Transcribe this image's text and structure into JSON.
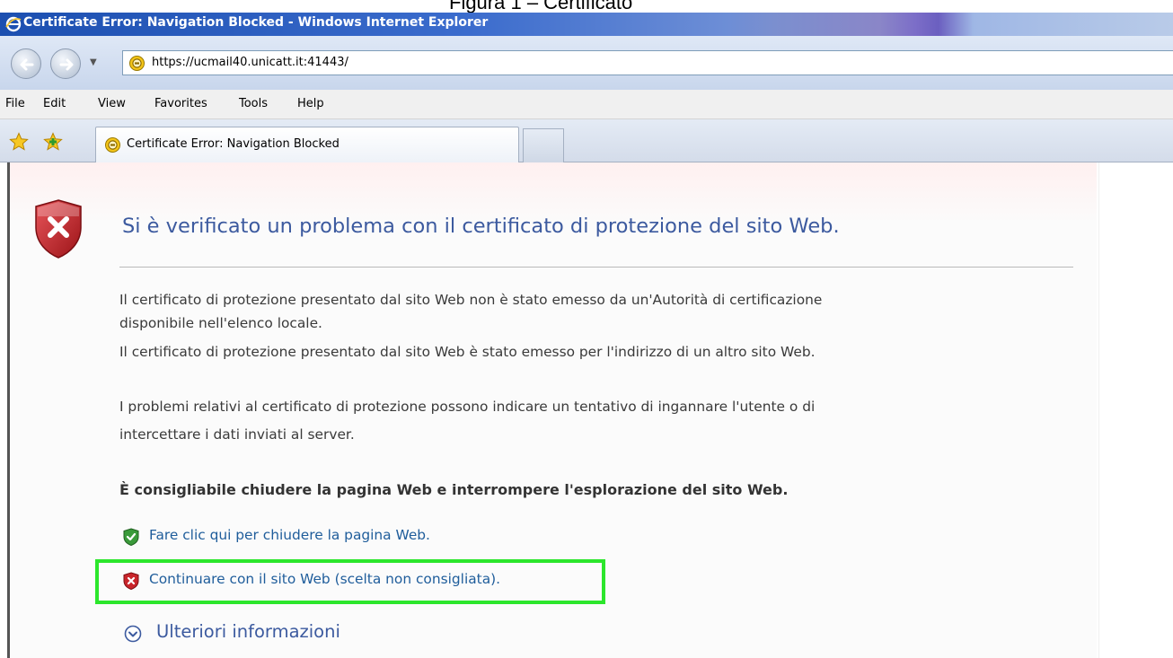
{
  "document_caption": "Figura 1 – Certificato",
  "window": {
    "title": "Certificate Error: Navigation Blocked - Windows Internet Explorer"
  },
  "address_bar": {
    "url": "https://ucmail40.unicatt.it:41443/",
    "dropdown_glyph": "▼"
  },
  "menu": {
    "items": [
      {
        "label": "File"
      },
      {
        "label": "Edit"
      },
      {
        "label": "View"
      },
      {
        "label": "Favorites"
      },
      {
        "label": "Tools"
      },
      {
        "label": "Help"
      }
    ]
  },
  "tabs": {
    "active_tab_label": "Certificate Error: Navigation Blocked"
  },
  "page": {
    "heading": "Si è verificato un problema con il certificato di protezione del sito Web.",
    "paragraph1_line1": "Il certificato di protezione presentato dal sito Web non è stato emesso da un'Autorità di certificazione",
    "paragraph1_line2": "disponibile nell'elenco locale.",
    "paragraph1_line3": "Il certificato di protezione presentato dal sito Web è stato emesso per l'indirizzo di un altro sito Web.",
    "paragraph2_line1": "I problemi relativi al certificato di protezione possono indicare un tentativo di ingannare l'utente o di",
    "paragraph2_line2": "intercettare i dati inviati al server.",
    "recommendation": "È consigliabile chiudere la pagina Web e interrompere l'esplorazione del sito Web.",
    "close_link": "Fare clic qui per chiudere la pagina Web.",
    "continue_link": "Continuare con il sito Web (scelta non consigliata).",
    "more_info_link": "Ulteriori informazioni"
  },
  "icons": {
    "ie_logo": "ie-logo-icon",
    "back": "back-arrow-icon",
    "forward": "forward-arrow-icon",
    "certificate_error": "certificate-error-icon",
    "favorites_star": "favorites-star-icon",
    "add_favorites": "add-favorites-icon",
    "shield_error": "shield-error-icon",
    "shield_ok": "shield-ok-icon",
    "expand": "chevron-down-circle-icon"
  },
  "colors": {
    "heading": "#3c5a9f",
    "link": "#1f5d9b",
    "highlight_box": "#2ce62c",
    "error_red": "#c9252b",
    "ok_green": "#3a9a3a"
  }
}
